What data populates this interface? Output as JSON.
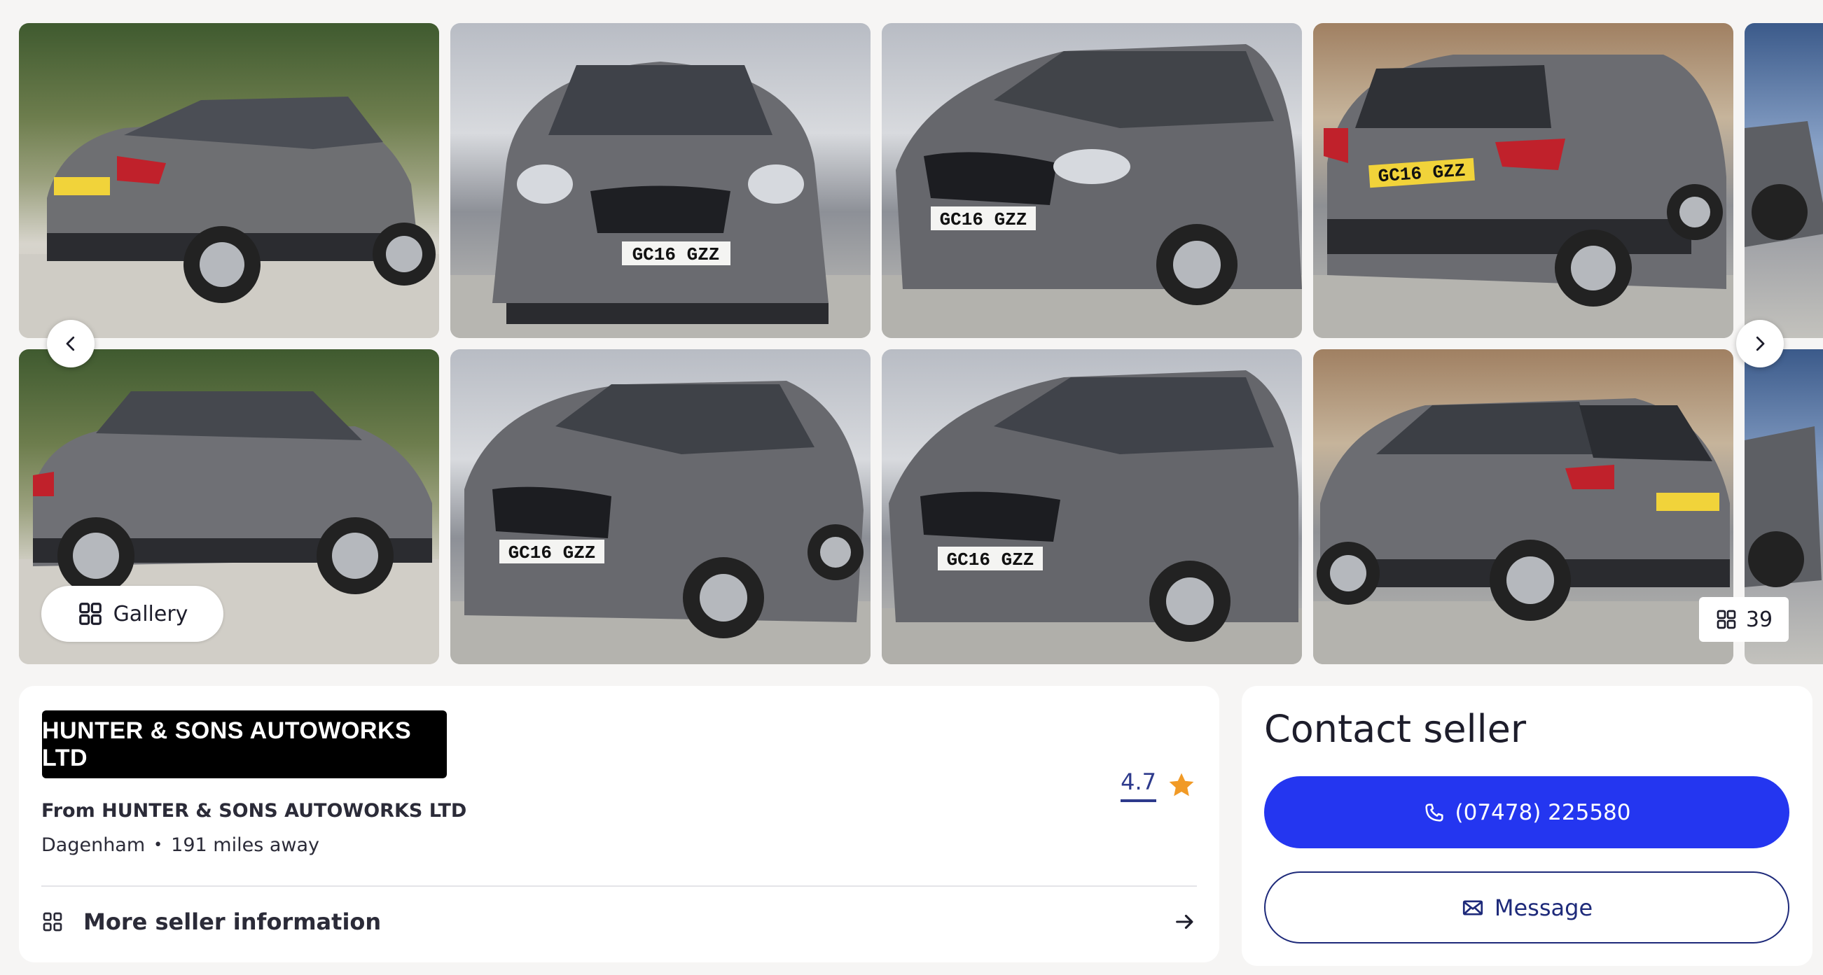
{
  "gallery": {
    "button_label": "Gallery",
    "photo_count": "39",
    "plate": "GC16 GZZ",
    "photos": [
      "car-rear-three-quarter",
      "car-front",
      "car-front-three-quarter",
      "car-rear",
      "car-side",
      "car-front-left",
      "car-front-right",
      "car-rear-left"
    ]
  },
  "seller": {
    "logo_text": "HUNTER & SONS AUTOWORKS LTD",
    "from_label": "From HUNTER & SONS AUTOWORKS LTD",
    "location": "Dagenham",
    "distance": "191 miles away",
    "rating": "4.7",
    "more_info_label": "More seller information"
  },
  "contact": {
    "title": "Contact seller",
    "phone_label": "(07478) 225580",
    "message_label": "Message"
  },
  "colors": {
    "primary": "#2436f0",
    "rating_star": "#f19a26",
    "rating_text": "#2d3a8c",
    "outline": "#1e2a7a"
  }
}
